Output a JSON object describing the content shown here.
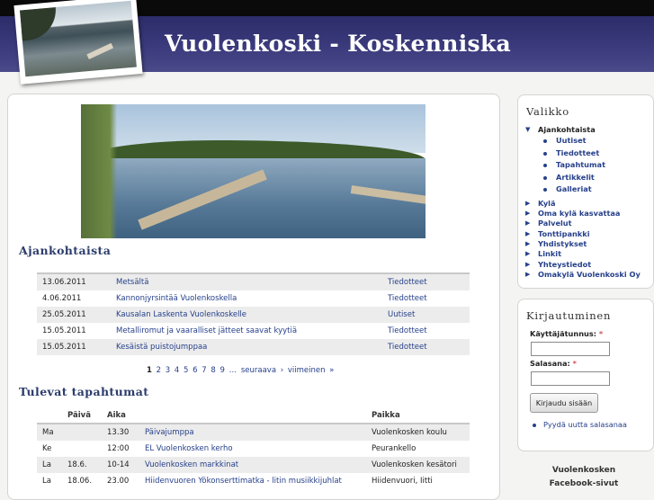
{
  "site": {
    "title": "Vuolenkoski - Koskenniska"
  },
  "news": {
    "heading": "Ajankohtaista",
    "rows": [
      {
        "date": "13.06.2011",
        "title": "Metsältä",
        "category": "Tiedotteet"
      },
      {
        "date": "4.06.2011",
        "title": "Kannonjyrsintää Vuolenkoskella",
        "category": "Tiedotteet"
      },
      {
        "date": "25.05.2011",
        "title": "Kausalan Laskenta Vuolenkoskelle",
        "category": "Uutiset"
      },
      {
        "date": "15.05.2011",
        "title": "Metalliromut ja vaaralliset jätteet saavat kyytiä",
        "category": "Tiedotteet"
      },
      {
        "date": "15.05.2011",
        "title": "Kesäistä puistojumppaa",
        "category": "Tiedotteet"
      }
    ],
    "pager": {
      "current": "1",
      "pages": [
        "2",
        "3",
        "4",
        "5",
        "6",
        "7",
        "8",
        "9"
      ],
      "ellipsis": "…",
      "next": "seuraava ›",
      "last": "viimeinen »"
    }
  },
  "events": {
    "heading": "Tulevat tapahtumat",
    "columns": {
      "day": "Päivä",
      "time": "Aika",
      "place": "Paikka"
    },
    "rows": [
      {
        "weekday": "Ma",
        "date": "",
        "time": "13.30",
        "title": "Päivajumppa",
        "place": "Vuolenkosken koulu"
      },
      {
        "weekday": "Ke",
        "date": "",
        "time": "12:00",
        "title": "EL Vuolenkosken kerho",
        "place": "Peurankello"
      },
      {
        "weekday": "La",
        "date": "18.6.",
        "time": "10-14",
        "title": "Vuolenkosken markkinat",
        "place": "Vuolenkosken kesätori"
      },
      {
        "weekday": "La",
        "date": "18.06.",
        "time": "23.00",
        "title": "Hiidenvuoren Yökonserttimatka - litin musiikkijuhlat",
        "place": "Hiidenvuori, Iitti"
      }
    ]
  },
  "menu": {
    "heading": "Valikko",
    "active": "Ajankohtaista",
    "subitems": [
      "Uutiset",
      "Tiedotteet",
      "Tapahtumat",
      "Artikkelit",
      "Galleriat"
    ],
    "items": [
      "Kylä",
      "Oma kylä kasvattaa",
      "Palvelut",
      "Tonttipankki",
      "Yhdistykset",
      "Linkit",
      "Yhteystiedot",
      "Omakylä Vuolenkoski Oy"
    ]
  },
  "login": {
    "heading": "Kirjautuminen",
    "username_label": "Käyttäjätunnus:",
    "password_label": "Salasana:",
    "required_mark": "*",
    "submit": "Kirjaudu sisään",
    "forgot": "Pyydä uutta salasanaa"
  },
  "facebook": {
    "line1": "Vuolenkosken",
    "line2": "Facebook-sivut"
  }
}
